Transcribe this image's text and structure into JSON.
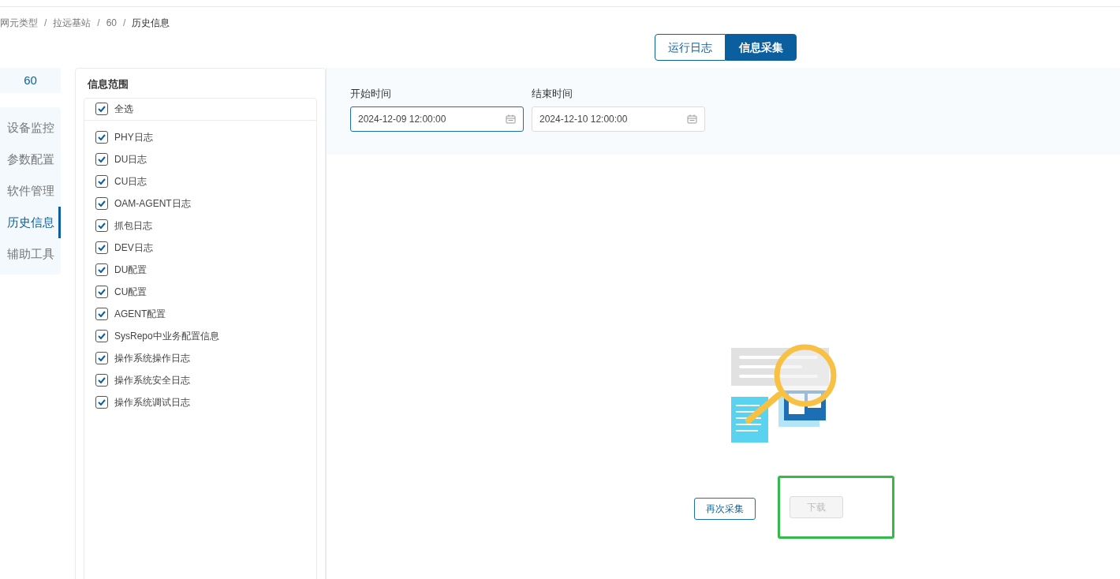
{
  "breadcrumb": [
    {
      "label": "网元类型",
      "current": false
    },
    {
      "label": "拉远基站",
      "current": false
    },
    {
      "label": "60",
      "current": false
    },
    {
      "label": "历史信息",
      "current": true
    }
  ],
  "breadcrumb_separator": "/",
  "tabs": [
    {
      "label": "运行日志",
      "selected": false
    },
    {
      "label": "信息采集",
      "selected": true
    }
  ],
  "device": "60",
  "nav": [
    {
      "label": "设备监控",
      "selected": false
    },
    {
      "label": "参数配置",
      "selected": false
    },
    {
      "label": "软件管理",
      "selected": false
    },
    {
      "label": "历史信息",
      "selected": true
    },
    {
      "label": "辅助工具",
      "selected": false
    }
  ],
  "scope": {
    "title": "信息范围",
    "select_all": {
      "label": "全选",
      "checked": true
    },
    "items": [
      {
        "label": "PHY日志",
        "checked": true
      },
      {
        "label": "DU日志",
        "checked": true
      },
      {
        "label": "CU日志",
        "checked": true
      },
      {
        "label": "OAM-AGENT日志",
        "checked": true
      },
      {
        "label": "抓包日志",
        "checked": true
      },
      {
        "label": "DEV日志",
        "checked": true
      },
      {
        "label": "DU配置",
        "checked": true
      },
      {
        "label": "CU配置",
        "checked": true
      },
      {
        "label": "AGENT配置",
        "checked": true
      },
      {
        "label": "SysRepo中业务配置信息",
        "checked": true
      },
      {
        "label": "操作系统操作日志",
        "checked": true
      },
      {
        "label": "操作系统安全日志",
        "checked": true
      },
      {
        "label": "操作系统调试日志",
        "checked": true
      }
    ]
  },
  "filters": [
    {
      "label": "开始时间",
      "value": "2024-12-09 12:00:00",
      "focused": true
    },
    {
      "label": "结束时间",
      "value": "2024-12-10 12:00:00",
      "focused": false
    }
  ],
  "actions": [
    {
      "label": "再次采集",
      "disabled": false,
      "highlighted": false
    },
    {
      "label": "下载",
      "disabled": true,
      "highlighted": true
    }
  ]
}
